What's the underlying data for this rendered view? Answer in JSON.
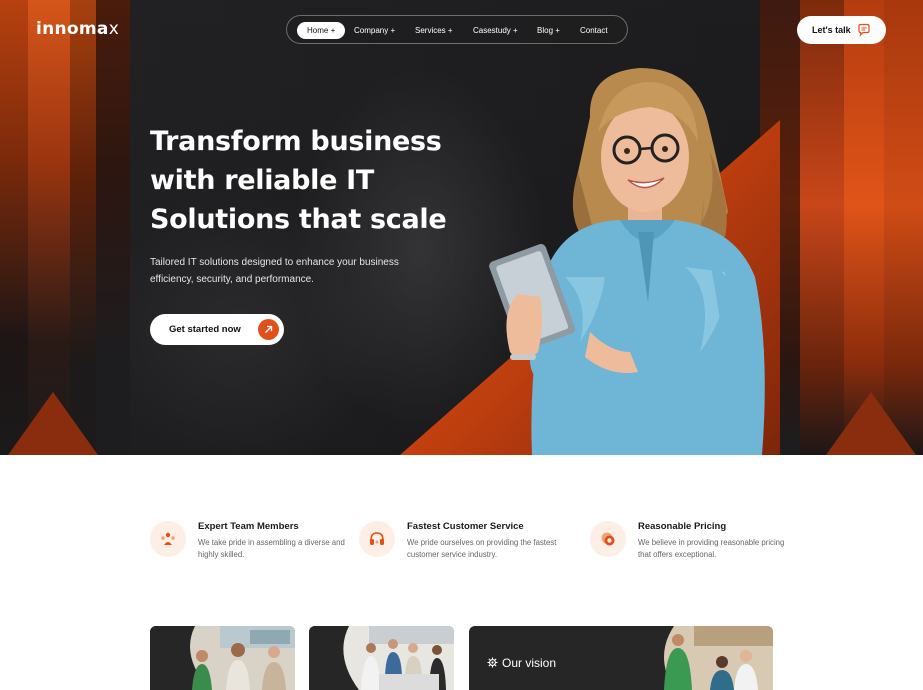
{
  "brand": {
    "logo_text": "innoma",
    "logo_mark": "x"
  },
  "nav": {
    "items": [
      {
        "label": "Home +",
        "active": true
      },
      {
        "label": "Company +",
        "active": false
      },
      {
        "label": "Services +",
        "active": false
      },
      {
        "label": "Casestudy +",
        "active": false
      },
      {
        "label": "Blog +",
        "active": false
      },
      {
        "label": "Contact",
        "active": false
      }
    ],
    "cta_label": "Let's talk"
  },
  "hero": {
    "title_lines": [
      "Transform business",
      "with reliable IT",
      "Solutions that scale"
    ],
    "subtitle": "Tailored IT solutions designed to enhance your business efficiency, security, and performance.",
    "cta_label": "Get started now"
  },
  "features": [
    {
      "icon": "team-icon",
      "title": "Expert Team Members",
      "description": "We take pride in assembling a diverse and highly skilled."
    },
    {
      "icon": "headset-icon",
      "title": "Fastest Customer Service",
      "description": "We pride ourselves on providing the fastest customer service industry."
    },
    {
      "icon": "coins-icon",
      "title": "Reasonable Pricing",
      "description": "We believe in providing reasonable pricing that offers exceptional."
    }
  ],
  "cards": {
    "vision_label": "Our vision"
  },
  "colors": {
    "accent": "#e0501a",
    "hero_bg": "#1d1d1f",
    "feature_icon_bg": "#fdeee6"
  }
}
